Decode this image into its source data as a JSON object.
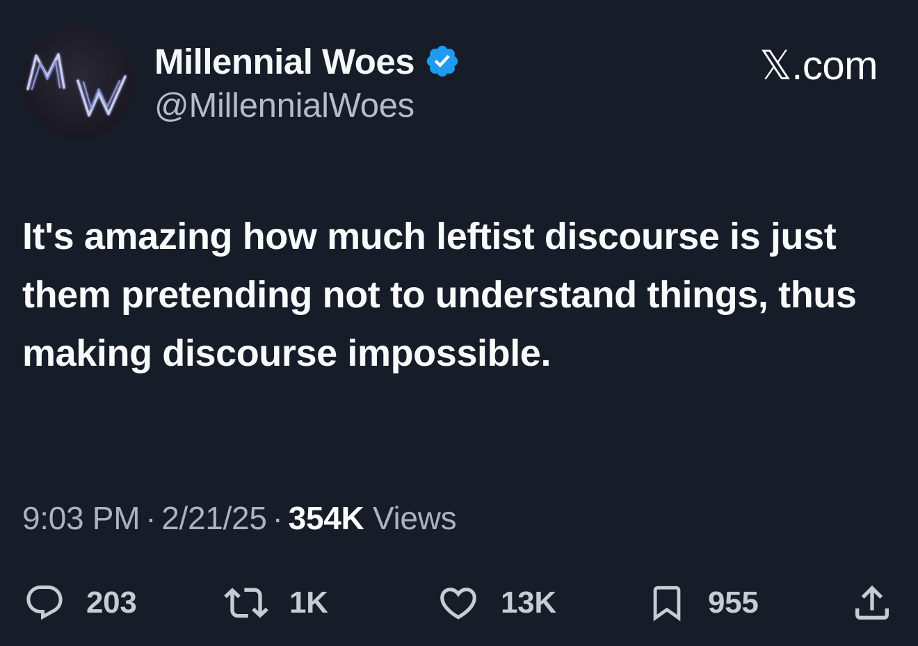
{
  "author": {
    "display_name": "Millennial Woes",
    "handle": "@MillennialWoes",
    "avatar_monogram": "MW",
    "verified": true
  },
  "brand": "𝕏.com",
  "tweet": {
    "text": "It's amazing how much leftist discourse is just them pretending not to understand things, thus making discourse impossible."
  },
  "meta": {
    "time": "9:03 PM",
    "separator": "·",
    "date": "2/21/25",
    "views_count": "354K",
    "views_label": "Views"
  },
  "actions": {
    "replies": "203",
    "reposts": "1K",
    "likes": "13K",
    "bookmarks": "955"
  },
  "icons": {
    "reply": "reply-icon",
    "repost": "repost-icon",
    "like": "heart-icon",
    "bookmark": "bookmark-icon",
    "share": "share-icon",
    "verified": "verified-badge-icon"
  },
  "colors": {
    "background": "#161d28",
    "verified_blue": "#1d9bf0",
    "muted_text": "#aab4be"
  }
}
